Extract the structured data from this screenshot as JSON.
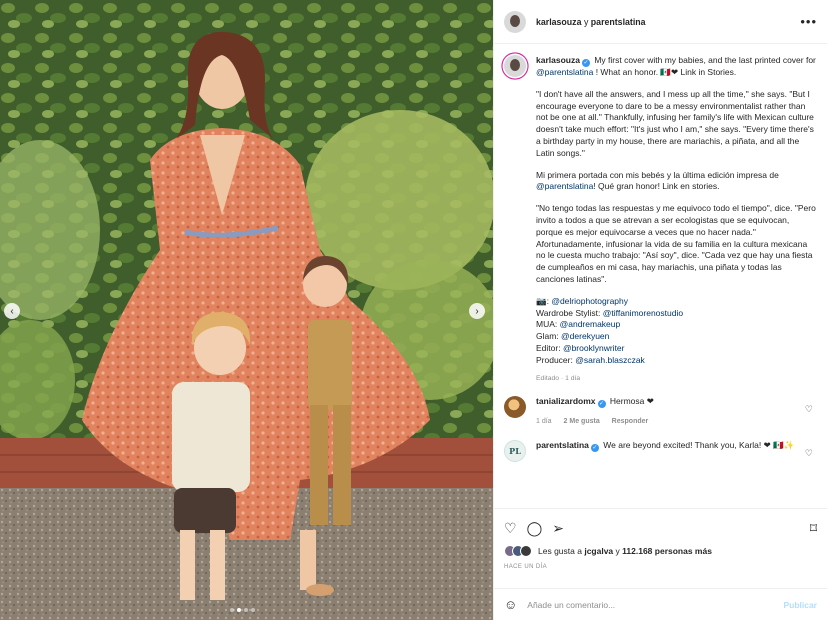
{
  "post": {
    "author": "karlasouza",
    "collab_separator": "y",
    "collaborator": "parentslatina"
  },
  "caption": {
    "intro": "My first cover with my babies, and the last printed cover for",
    "mention1": "@parentslatina",
    "intro2": "! What an honor. 🇲🇽❤ Link in Stories.",
    "p1": "\"I don't have all the answers, and I mess up all the time,\" she says. \"But I encourage everyone to dare to be a messy environmentalist rather than not be one at all.\" Thankfully, infusing her family's life with Mexican culture doesn't take much effort: \"It's just who I am,\" she says. \"Every time there's a birthday party in my house, there are mariachis, a piñata, and all the Latin songs.\"",
    "p2a": "Mi primera portada con mis bebés y la última edición impresa de",
    "p2_mention": "@parentslatina",
    "p2b": "! Qué gran honor! Link en stories.",
    "p3": "\"No tengo todas las respuestas y me equivoco todo el tiempo\", dice. \"Pero invito a todos a que se atrevan a ser ecologistas que se equivocan, porque es mejor equivocarse a veces que no hacer nada.\" Afortunadamente, infusionar la vida de su familia en la cultura mexicana no le cuesta mucho trabajo: \"Así soy\", dice. \"Cada vez que hay una fiesta de cumpleaños en mi casa, hay mariachis, una piñata y todas las canciones latinas\".",
    "credits": [
      {
        "label": "📷:",
        "handle": "@delriophotography"
      },
      {
        "label": "Wardrobe Stylist:",
        "handle": "@tiffanimorenostudio"
      },
      {
        "label": "MUA:",
        "handle": "@andremakeup"
      },
      {
        "label": "Glam:",
        "handle": "@derekyuen"
      },
      {
        "label": "Editor:",
        "handle": "@brooklynwriter"
      },
      {
        "label": "Producer:",
        "handle": "@sarah.blaszczak"
      }
    ],
    "meta": "Editado · 1 día"
  },
  "comments": [
    {
      "user": "tanializardomx",
      "text": "Hermosa ❤",
      "time": "1 día",
      "likes": "2 Me gusta",
      "reply": "Responder"
    },
    {
      "user": "parentslatina",
      "text": "We are beyond excited! Thank you, Karla! ❤ 🇲🇽✨"
    }
  ],
  "likes": {
    "prefix": "Les gusta a",
    "user": "jcgalva",
    "mid": "y",
    "count": "112.168 personas más"
  },
  "time_ago": "HACE UN DÍA",
  "composer": {
    "placeholder": "Añade un comentario...",
    "post_label": "Publicar"
  },
  "icons": {
    "more": "more-icon",
    "like": "heart-icon",
    "comment": "comment-icon",
    "share": "share-icon",
    "save": "bookmark-icon",
    "emoji": "emoji-icon"
  },
  "colors": {
    "link": "#00376b",
    "verified": "#3897f0",
    "heart": "#ed4956",
    "post_button": "#b2dffc"
  }
}
